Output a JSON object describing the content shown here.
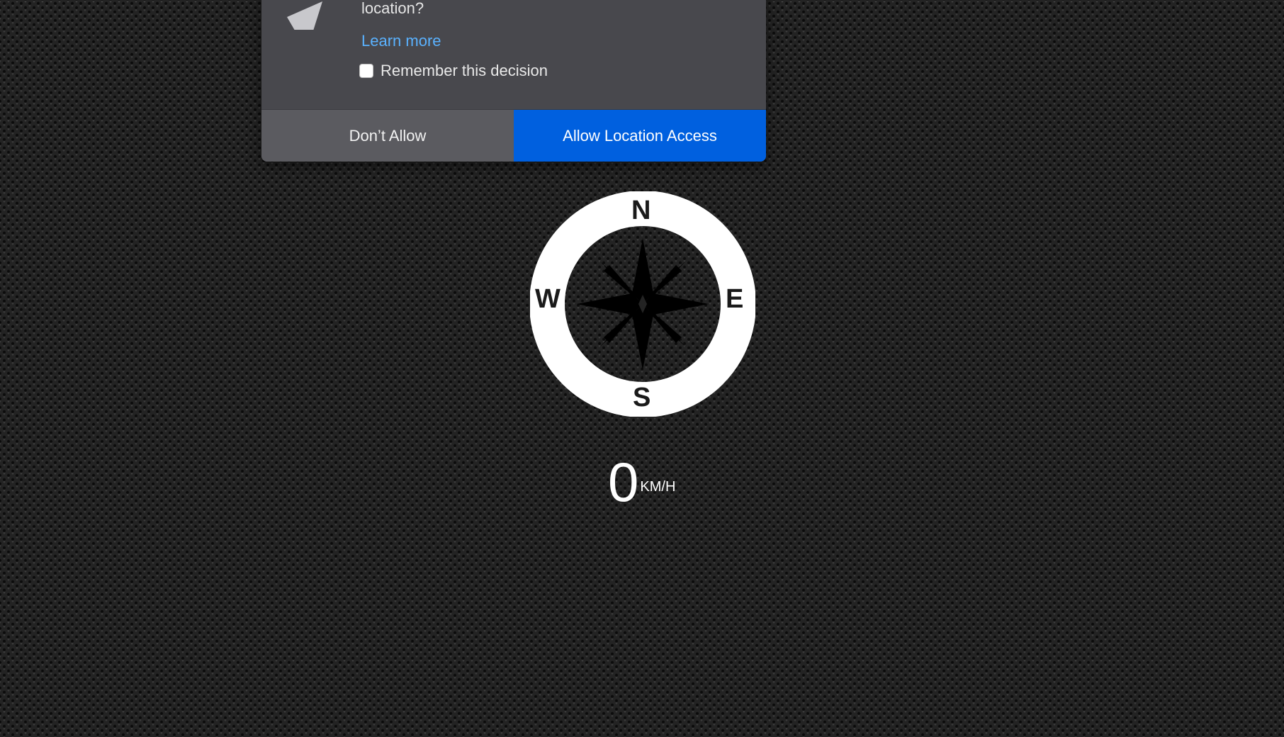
{
  "permission_prompt": {
    "question": "location?",
    "learn_more": "Learn more",
    "remember_label": "Remember this decision",
    "remember_checked": false,
    "deny_label": "Don’t Allow",
    "allow_label": "Allow Location Access",
    "icon": "location-arrow-icon",
    "colors": {
      "panel": "#48484d",
      "link": "#5ab2ff",
      "allow_button": "#0060df",
      "deny_button": "#5b5b60"
    }
  },
  "compass": {
    "north": "N",
    "south": "S",
    "east": "E",
    "west": "W",
    "icon": "compass-rose-icon"
  },
  "speed": {
    "value": "0",
    "unit": "KM/H"
  }
}
